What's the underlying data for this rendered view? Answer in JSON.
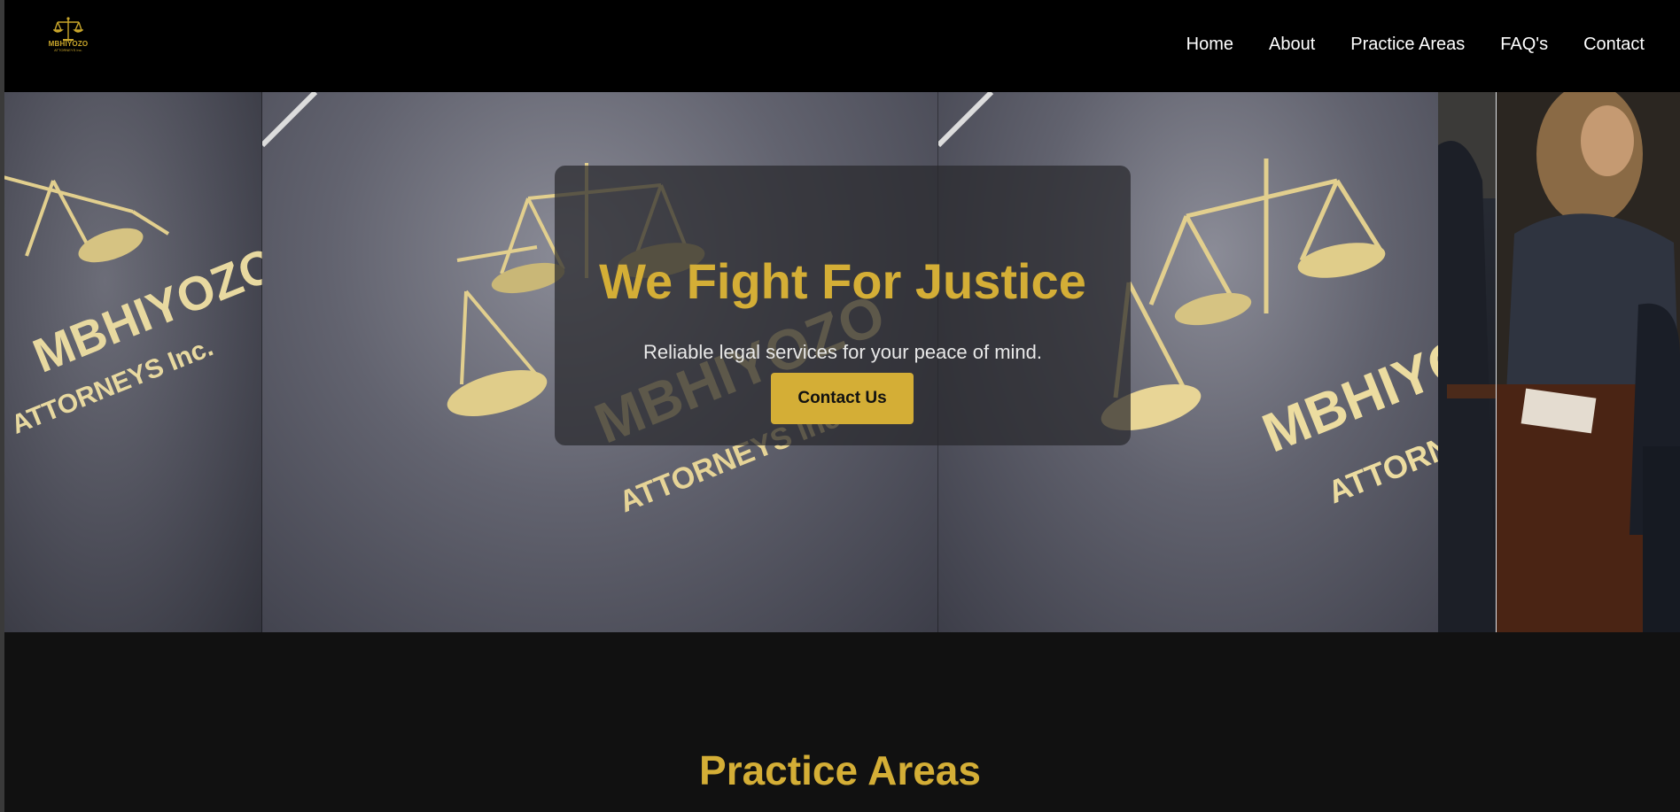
{
  "brand": {
    "logo_name": "MBHIYOZO",
    "logo_sub": "ATTORNEYS Inc.",
    "accent": "#d4ae36"
  },
  "nav": {
    "items": [
      {
        "label": "Home"
      },
      {
        "label": "About"
      },
      {
        "label": "Practice Areas"
      },
      {
        "label": "FAQ's"
      },
      {
        "label": "Contact"
      }
    ]
  },
  "hero": {
    "title": "We Fight For Justice",
    "subtitle": "Reliable legal services for your peace of mind.",
    "button_label": "Contact Us",
    "background_image_text": {
      "brand": "MBHIYOZO",
      "sub": "ATTORNEYS Inc."
    }
  },
  "practice_section": {
    "title": "Practice Areas"
  },
  "icons": {
    "logo": "scales-of-justice-icon"
  }
}
